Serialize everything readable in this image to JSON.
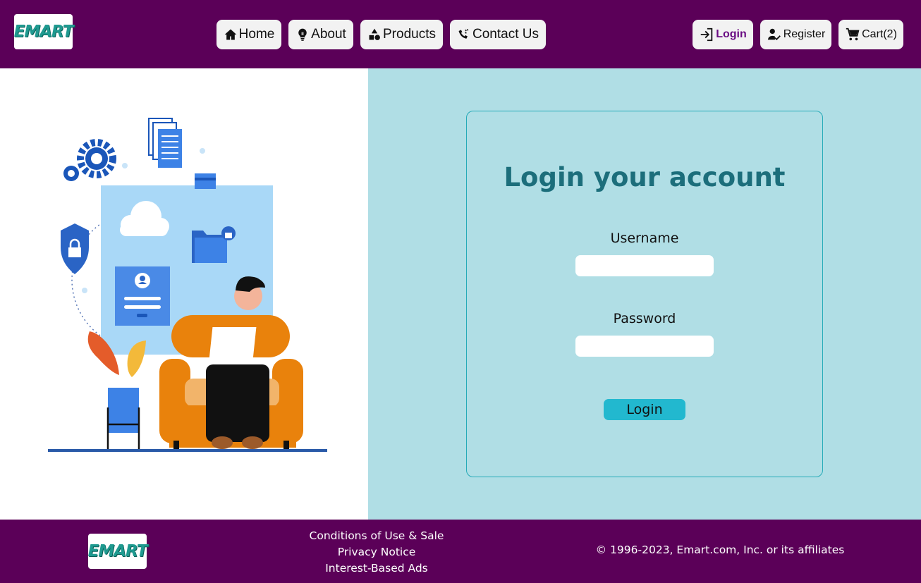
{
  "header": {
    "logo_text": "EMART",
    "nav": [
      {
        "label": "Home",
        "icon": "home-icon"
      },
      {
        "label": "About",
        "icon": "lightbulb-icon"
      },
      {
        "label": "Products",
        "icon": "shapes-icon"
      },
      {
        "label": "Contact Us",
        "icon": "contact-icon"
      }
    ],
    "account": [
      {
        "label": "Login",
        "icon": "login-icon"
      },
      {
        "label": "Register",
        "icon": "register-icon"
      },
      {
        "label": "Cart(2)",
        "icon": "cart-icon"
      }
    ]
  },
  "login": {
    "title": "Login your account",
    "username_label": "Username",
    "username_value": "",
    "password_label": "Password",
    "password_value": "",
    "button_label": "Login"
  },
  "footer": {
    "logo_text": "EMART",
    "links": [
      "Conditions of Use & Sale",
      "Privacy Notice",
      "Interest-Based Ads"
    ],
    "copyright": "© 1996-2023, Emart.com, Inc. or its affiliates"
  },
  "colors": {
    "header_bg": "#5b0058",
    "right_pane_bg": "#b0dee5",
    "title_color": "#1c6e7b",
    "button_bg": "#22b8cf",
    "active_nav": "#6a0d83"
  }
}
